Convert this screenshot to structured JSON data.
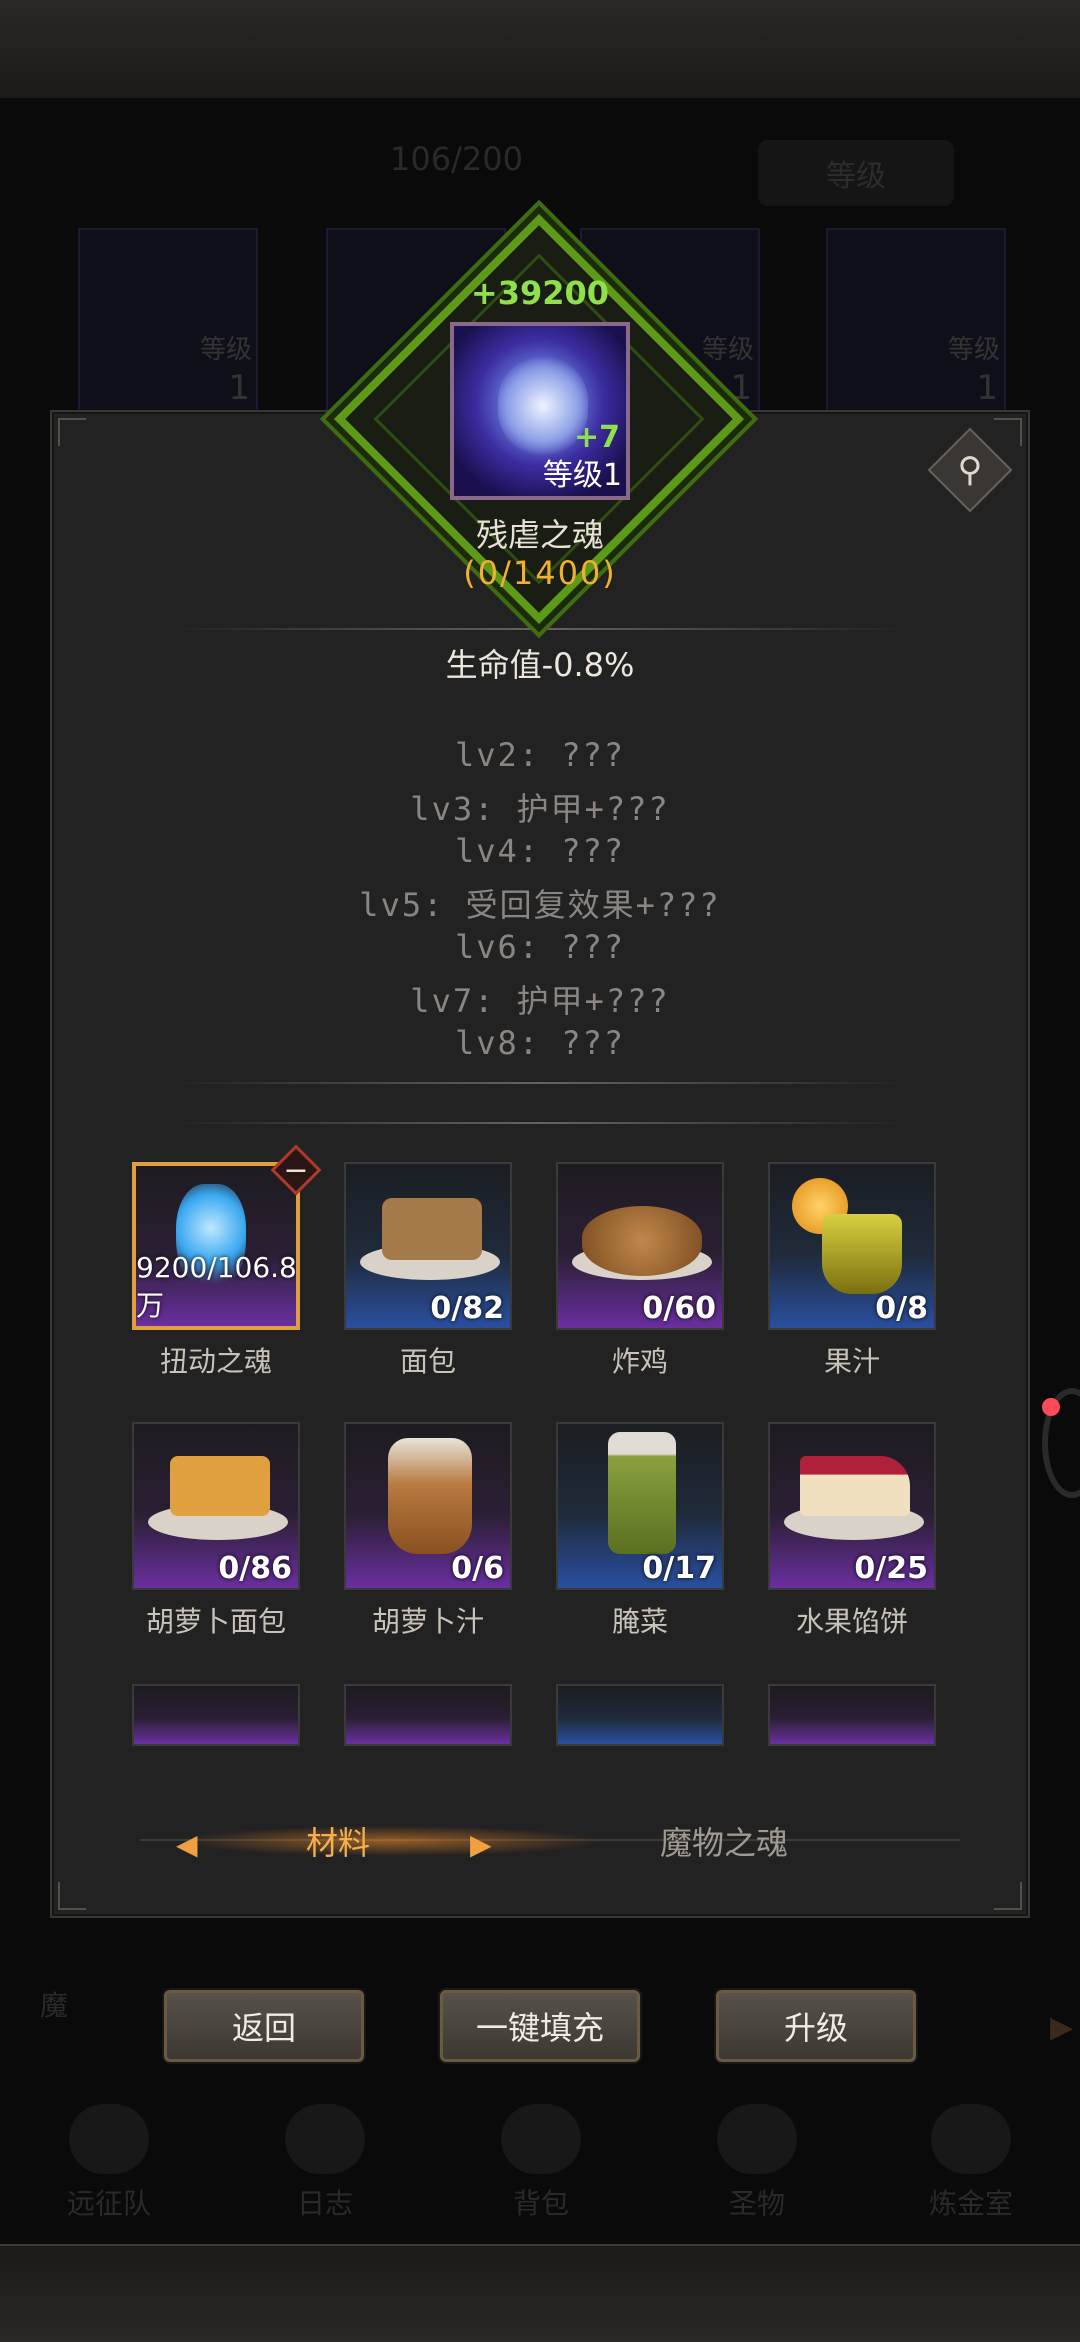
{
  "background": {
    "count": "106/200",
    "level_button": "等级",
    "cards": [
      {
        "label": "等级",
        "num": "1"
      },
      {
        "label": "等级",
        "num": "1"
      },
      {
        "label": "等级",
        "num": "1"
      },
      {
        "label": "等级",
        "num": "1"
      }
    ],
    "side_tab": "魔",
    "nav": [
      "远征队",
      "日志",
      "背包",
      "圣物",
      "炼金室"
    ]
  },
  "soul": {
    "exp_gain": "+39200",
    "plus": "+7",
    "level": "等级1",
    "name": "残虐之魂",
    "progress": "(0/1400)"
  },
  "stats": {
    "main": "生命值-0.8%",
    "levels": [
      "lv2: ???",
      "lv3: 护甲+???",
      "lv4: ???",
      "lv5: 受回复效果+???",
      "lv6: ???",
      "lv7: 护甲+???",
      "lv8: ???"
    ]
  },
  "items": [
    {
      "label": "扭动之魂",
      "count": "9200/106.8万",
      "tone": "purple",
      "selected": true
    },
    {
      "label": "面包",
      "count": "0/82",
      "tone": "blue"
    },
    {
      "label": "炸鸡",
      "count": "0/60",
      "tone": "purple"
    },
    {
      "label": "果汁",
      "count": "0/8",
      "tone": "blue"
    },
    {
      "label": "胡萝卜面包",
      "count": "0/86",
      "tone": "purple"
    },
    {
      "label": "胡萝卜汁",
      "count": "0/6",
      "tone": "purple"
    },
    {
      "label": "腌菜",
      "count": "0/17",
      "tone": "blue"
    },
    {
      "label": "水果馅饼",
      "count": "0/25",
      "tone": "purple"
    }
  ],
  "tabs": {
    "materials": "材料",
    "monster_souls": "魔物之魂"
  },
  "buttons": {
    "back": "返回",
    "auto_fill": "一键填充",
    "upgrade": "升级"
  },
  "colors": {
    "accent_green": "#8fe04a",
    "accent_orange": "#f0b030",
    "panel": "#232222"
  }
}
